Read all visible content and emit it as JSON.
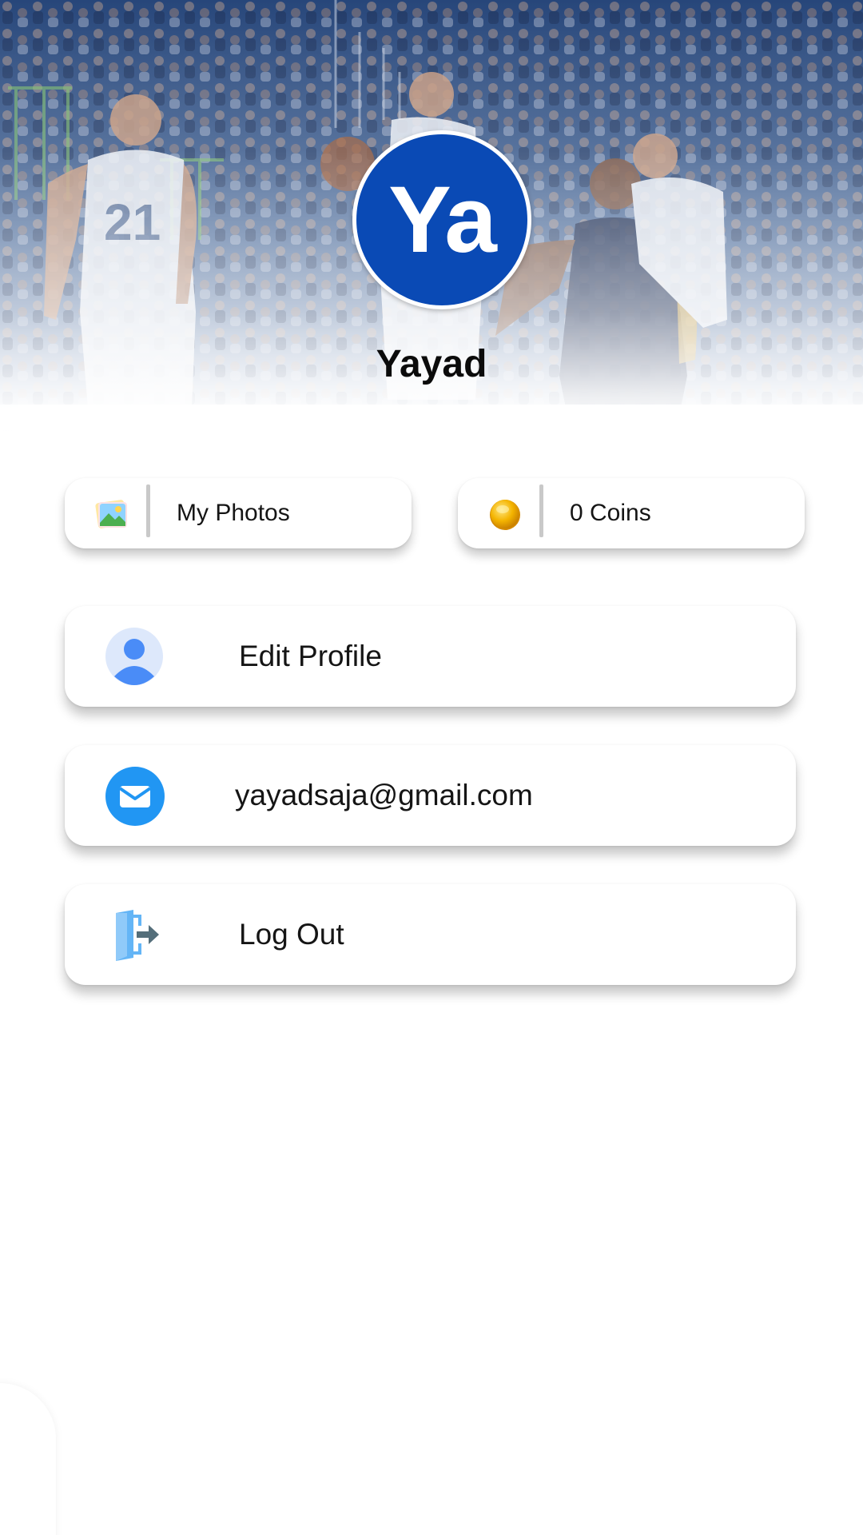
{
  "profile": {
    "avatar_initials": "Ya",
    "name": "Yayad"
  },
  "stats": {
    "photos_label": "My Photos",
    "coins_label": "0 Coins"
  },
  "menu": {
    "edit_profile_label": "Edit Profile",
    "email_label": "yayadsaja@gmail.com",
    "logout_label": "Log Out"
  },
  "icons": {
    "photos": "image-gallery-icon",
    "coins": "gold-coin-icon",
    "edit_profile": "user-icon",
    "email": "mail-icon",
    "logout": "logout-door-icon"
  },
  "colors": {
    "avatar_bg": "#0a4ab5",
    "accent_blue": "#2196f3",
    "coin_gold": "#f4b400"
  }
}
